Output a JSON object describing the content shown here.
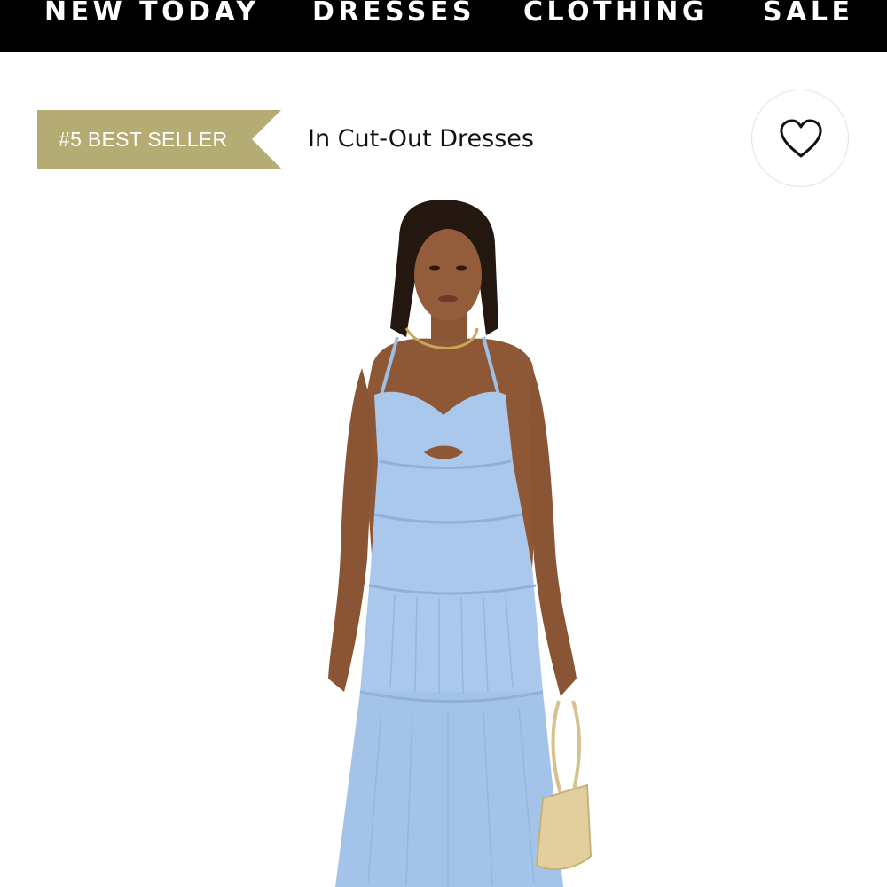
{
  "nav": {
    "items": [
      {
        "label": "NEW TODAY"
      },
      {
        "label": "DRESSES"
      },
      {
        "label": "CLOTHING"
      },
      {
        "label": "SALE"
      }
    ]
  },
  "badge": {
    "label": "#5 BEST SELLER",
    "category": "In Cut-Out Dresses",
    "color": "#b4ac72"
  },
  "wishlist": {
    "icon": "heart-outline-icon"
  },
  "product": {
    "dress_color": "#a9c8ec",
    "image": "product-photo-model-blue-tiered-dress"
  },
  "colors": {
    "nav_bg": "#000000",
    "nav_text": "#ffffff",
    "page_bg": "#ffffff"
  }
}
